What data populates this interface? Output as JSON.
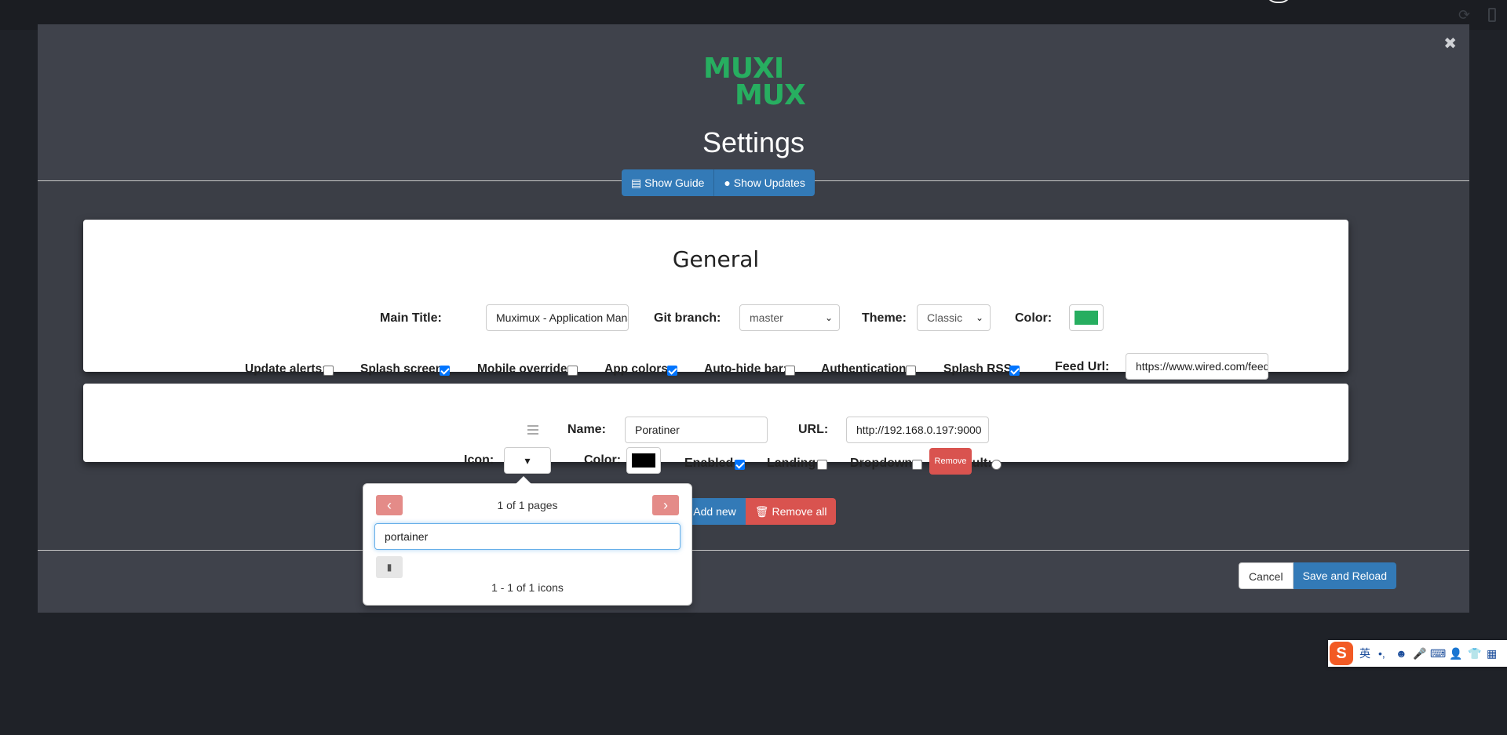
{
  "app": {
    "logo_line1": "MUXI",
    "logo_line2": "MUX",
    "title": "Settings",
    "close_glyph": "✖",
    "accent_color": "#27ae60"
  },
  "guide_buttons": {
    "show_guide": "Show Guide",
    "show_updates": "Show Updates"
  },
  "general": {
    "heading": "General",
    "main_title_label": "Main Title:",
    "main_title_value": "Muximux - Application Management",
    "git_branch_label": "Git branch:",
    "git_branch_value": "master",
    "theme_label": "Theme:",
    "theme_value": "Classic",
    "color_label": "Color:",
    "color_value": "#27ae60",
    "checkboxes": [
      {
        "label": "Update alerts:",
        "checked": false
      },
      {
        "label": "Splash screen:",
        "checked": true
      },
      {
        "label": "Mobile override:",
        "checked": false
      },
      {
        "label": "App colors:",
        "checked": true
      },
      {
        "label": "Auto-hide bar:",
        "checked": false
      },
      {
        "label": "Authentication:",
        "checked": false
      },
      {
        "label": "Splash RSS:",
        "checked": true
      }
    ],
    "feed_url_label": "Feed Url:",
    "feed_url_value": "https://www.wired.com/feed/rss"
  },
  "app_item": {
    "name_label": "Name:",
    "name_value": "Poratiner",
    "url_label": "URL:",
    "url_value": "http://192.168.0.197:9000",
    "icon_label": "Icon:",
    "color_label": "Color:",
    "color_value": "#000000",
    "enabled_label": "Enabled:",
    "enabled": true,
    "landing_label": "Landing:",
    "landing": false,
    "dropdown_label": "Dropdown:",
    "dropdown": false,
    "default_label": "Default:",
    "default": false,
    "remove_label": "Remove"
  },
  "icon_picker": {
    "prev_glyph": "‹",
    "next_glyph": "›",
    "pages_text": "1 of 1 pages",
    "search_value": "portainer",
    "count_text": "1 - 1 of 1 icons",
    "result_icon": "portainer-icon"
  },
  "list_actions": {
    "add_new": "Add new",
    "remove_all": "Remove all"
  },
  "footer": {
    "cancel": "Cancel",
    "save": "Save and Reload"
  },
  "ime": {
    "logo": "S",
    "lang": "英"
  }
}
